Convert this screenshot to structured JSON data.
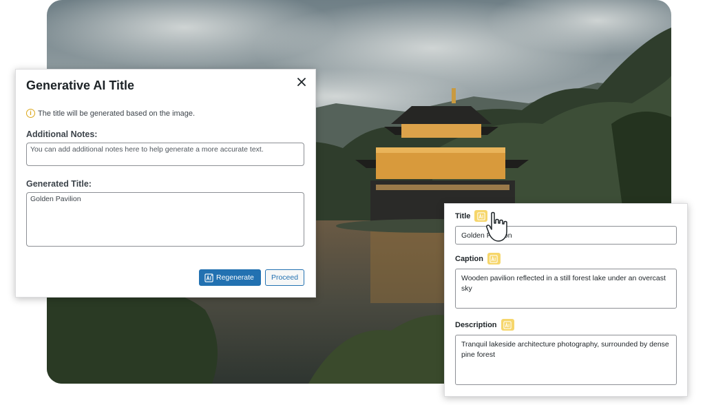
{
  "dialog": {
    "title": "Generative AI Title",
    "notice": "The title will be generated based on the image.",
    "notes_label": "Additional Notes:",
    "notes_placeholder": "You can add additional notes here to help generate a more accurate text.",
    "generated_label": "Generated Title:",
    "generated_value": "Golden Pavilion",
    "regenerate_label": "Regenerate",
    "proceed_label": "Proceed"
  },
  "panel": {
    "title_label": "Title",
    "title_value": "Golden Pavilion",
    "caption_label": "Caption",
    "caption_value": "Wooden pavilion reflected in a still forest lake under an overcast sky",
    "description_label": "Description",
    "description_value": "Tranquil lakeside architecture photography, surrounded by dense pine forest"
  },
  "icons": {
    "close": "close-icon",
    "info": "info-icon",
    "ai": "ai-generate-icon",
    "cursor": "pointer-cursor-icon"
  },
  "colors": {
    "primary": "#2271b1",
    "ai_badge": "#f6d66b",
    "info": "#dba617"
  }
}
